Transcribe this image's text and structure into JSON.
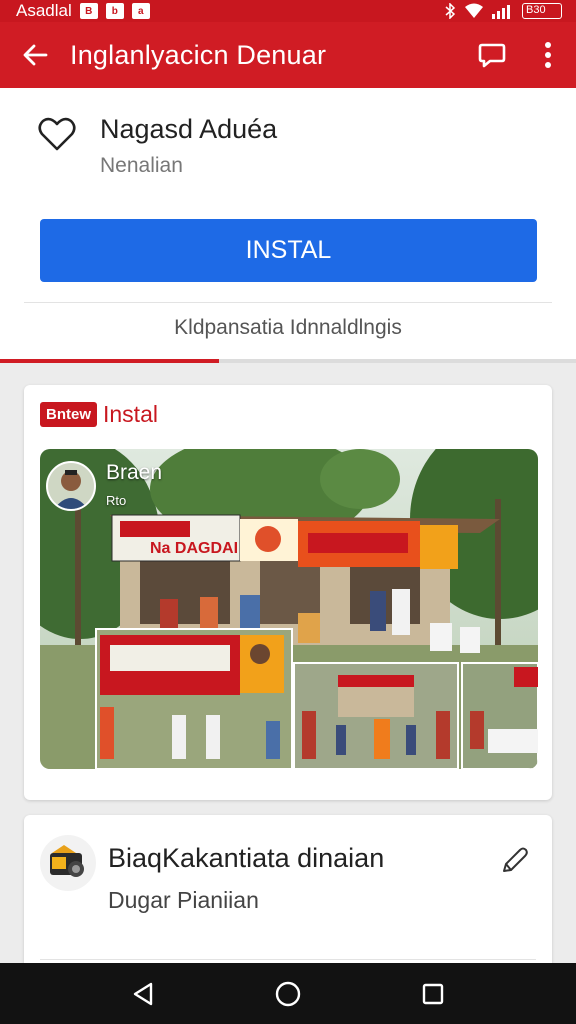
{
  "status_bar": {
    "carrier": "Asadlal",
    "mini_icon_1": "B",
    "mini_icon_2": "b",
    "mini_icon_3": "a",
    "battery": "B30"
  },
  "app_bar": {
    "title": "Inglanlyacicn Denuar",
    "back_icon": "arrow-back-icon",
    "action_icon": "chat-bubble-icon",
    "menu_icon": "more-vert-icon"
  },
  "app_info": {
    "name": "Nagasd Aduéa",
    "subtitle": "Nenalian",
    "install_label": "INSTAL",
    "more_info": "Kldpansatia Idnnaldlngis",
    "progress_percent": 38
  },
  "post": {
    "badge": "Bntew",
    "label": "Instal",
    "photo_user": "Braen",
    "photo_sub": "Rto",
    "banner_text": "Na DAGDAI"
  },
  "second_item": {
    "title": "BiaqKakantiata dinaian",
    "subtitle": "Dugar Pianiian"
  },
  "colors": {
    "brand_red": "#d01c24",
    "install_blue": "#1e6ae6"
  }
}
